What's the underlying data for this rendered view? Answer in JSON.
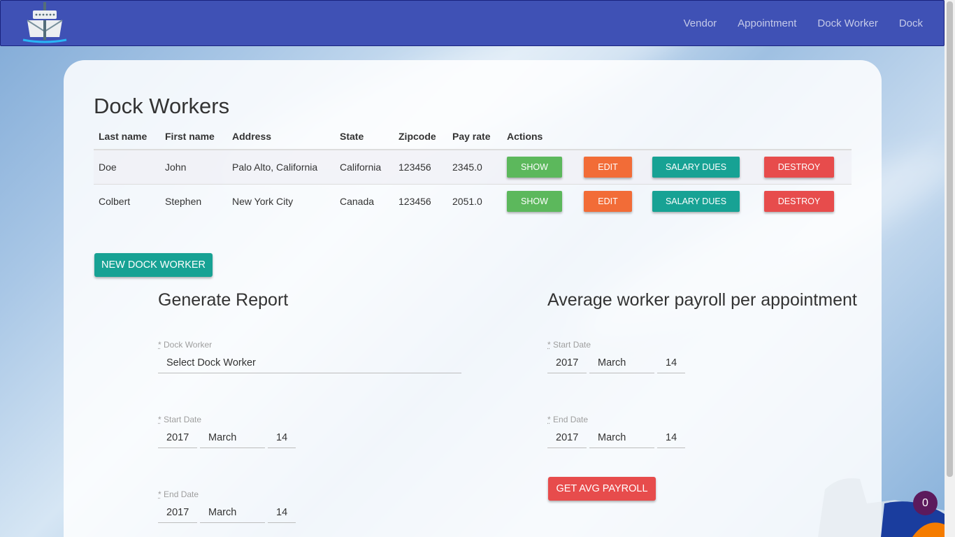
{
  "nav": {
    "links": [
      "Vendor",
      "Appointment",
      "Dock Worker",
      "Dock"
    ]
  },
  "page": {
    "title": "Dock Workers"
  },
  "table": {
    "headers": [
      "Last name",
      "First name",
      "Address",
      "State",
      "Zipcode",
      "Pay rate",
      "Actions"
    ],
    "rows": [
      {
        "last_name": "Doe",
        "first_name": "John",
        "address": "Palo Alto, California",
        "state": "California",
        "zipcode": "123456",
        "pay_rate": "2345.0"
      },
      {
        "last_name": "Colbert",
        "first_name": "Stephen",
        "address": "New York City",
        "state": "Canada",
        "zipcode": "123456",
        "pay_rate": "2051.0"
      }
    ],
    "actions": {
      "show": "SHOW",
      "edit": "EDIT",
      "salary": "SALARY DUES",
      "destroy": "DESTROY"
    }
  },
  "new_button": "NEW DOCK WORKER",
  "report": {
    "title": "Generate Report",
    "worker_label": "Dock Worker",
    "worker_value": "Select Dock Worker",
    "start_label": "Start Date",
    "start": {
      "year": "2017",
      "month": "March",
      "day": "14"
    },
    "end_label": "End Date",
    "end": {
      "year": "2017",
      "month": "March",
      "day": "14"
    }
  },
  "avg": {
    "title": "Average worker payroll per appointment",
    "start_label": "Start Date",
    "start": {
      "year": "2017",
      "month": "March",
      "day": "14"
    },
    "end_label": "End Date",
    "end": {
      "year": "2017",
      "month": "March",
      "day": "14"
    },
    "button": "GET AVG PAYROLL"
  },
  "required_mark": "*",
  "badge_count": "0",
  "colors": {
    "navbar": "#3f51b5",
    "show": "#5cb85c",
    "edit": "#f26c37",
    "teal": "#17a294",
    "red": "#e74c4c",
    "badge": "#5c1a5c"
  }
}
